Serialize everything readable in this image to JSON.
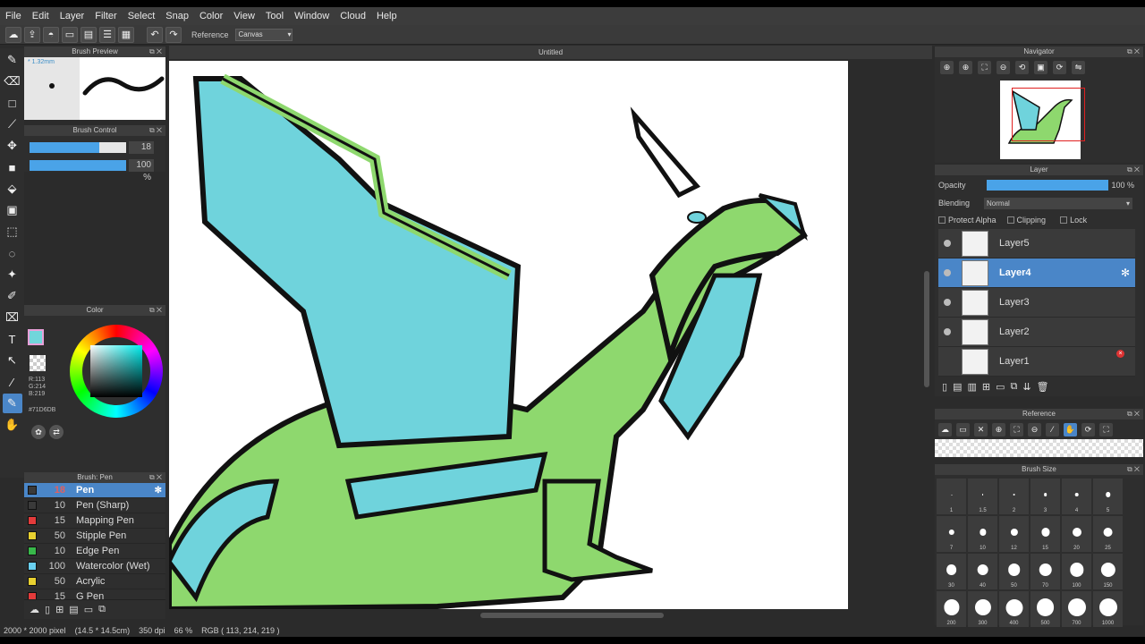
{
  "menu": [
    "File",
    "Edit",
    "Layer",
    "Filter",
    "Select",
    "Snap",
    "Color",
    "View",
    "Tool",
    "Window",
    "Cloud",
    "Help"
  ],
  "toolbar": {
    "reference_label": "Reference",
    "reference_value": "Canvas"
  },
  "brush_preview": {
    "title": "Brush Preview",
    "size_text": "* 1.32mm"
  },
  "brush_control": {
    "title": "Brush Control",
    "size_value": "18",
    "size_fill": 0.72,
    "opacity_value": "100 %",
    "opacity_fill": 1.0
  },
  "color": {
    "title": "Color",
    "rgb_r": "R:113",
    "rgb_g": "G:214",
    "rgb_b": "B:219",
    "hex": "#71D6DB",
    "current": "#71d6db"
  },
  "brush_list": {
    "title": "Brush: Pen",
    "items": [
      {
        "size": "18",
        "name": "Pen",
        "color": "#3a3a3a",
        "selected": true
      },
      {
        "size": "10",
        "name": "Pen (Sharp)",
        "color": "#3a3a3a"
      },
      {
        "size": "15",
        "name": "Mapping Pen",
        "color": "#e33b3b"
      },
      {
        "size": "50",
        "name": "Stipple Pen",
        "color": "#e8d030"
      },
      {
        "size": "10",
        "name": "Edge Pen",
        "color": "#38b84a"
      },
      {
        "size": "100",
        "name": "Watercolor (Wet)",
        "color": "#6ad0f0"
      },
      {
        "size": "50",
        "name": "Acrylic",
        "color": "#e8d030"
      },
      {
        "size": "15",
        "name": "G Pen",
        "color": "#e33b3b"
      }
    ]
  },
  "canvas": {
    "title": "Untitled"
  },
  "status": {
    "size": "2000 * 2000 pixel",
    "physical": "(14.5 * 14.5cm)",
    "dpi": "350 dpi",
    "zoom": "66 %",
    "rgb": "RGB ( 113, 214, 219 )"
  },
  "navigator": {
    "title": "Navigator"
  },
  "layer": {
    "title": "Layer",
    "opacity_label": "Opacity",
    "opacity_value": "100 %",
    "blending_label": "Blending",
    "blending_value": "Normal",
    "protect_alpha": "Protect Alpha",
    "clipping": "Clipping",
    "lock": "Lock",
    "items": [
      {
        "name": "Layer5",
        "visible": true
      },
      {
        "name": "Layer4",
        "visible": true,
        "selected": true
      },
      {
        "name": "Layer3",
        "visible": true
      },
      {
        "name": "Layer2",
        "visible": true
      },
      {
        "name": "Layer1",
        "visible": false
      }
    ]
  },
  "reference": {
    "title": "Reference"
  },
  "brush_size": {
    "title": "Brush Size",
    "sizes": [
      "1",
      "1.5",
      "2",
      "3",
      "4",
      "5",
      "7",
      "10",
      "12",
      "15",
      "20",
      "25",
      "30",
      "40",
      "50",
      "70",
      "100",
      "150",
      "200",
      "300",
      "400",
      "500",
      "700",
      "1000"
    ]
  }
}
